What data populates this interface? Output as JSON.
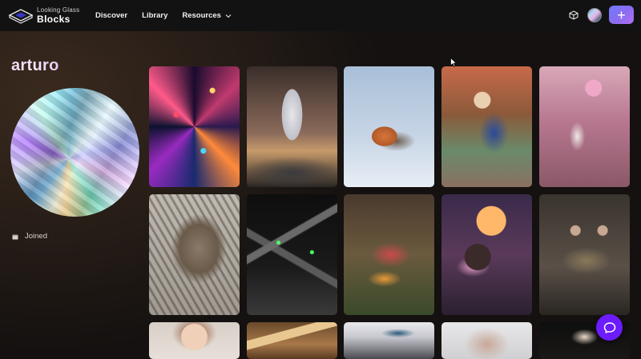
{
  "header": {
    "logo_top": "Looking Glass",
    "logo_bottom": "Blocks",
    "nav": [
      {
        "label": "Discover"
      },
      {
        "label": "Library"
      },
      {
        "label": "Resources"
      }
    ],
    "create_button_icon": "plus-icon",
    "accent_color": "#7a6cf5"
  },
  "profile": {
    "username": "arturo",
    "joined_label": "Joined"
  },
  "gallery": {
    "tiles": [
      {
        "name": "crystals-tile"
      },
      {
        "name": "rocket-tile"
      },
      {
        "name": "robin-bird-tile"
      },
      {
        "name": "popeye-tile"
      },
      {
        "name": "vintage-room-tile"
      },
      {
        "name": "sleeping-cat-tile"
      },
      {
        "name": "x-wing-tile"
      },
      {
        "name": "food-platter-tile"
      },
      {
        "name": "girl-at-desk-tile"
      },
      {
        "name": "board-game-tile"
      },
      {
        "name": "anime-character-tile"
      },
      {
        "name": "sign-tile"
      },
      {
        "name": "airplane-tile"
      },
      {
        "name": "baby-tile"
      },
      {
        "name": "hand-tile"
      }
    ]
  },
  "support": {
    "chat_icon": "chat-bubble-icon",
    "color": "#6c1cff"
  }
}
